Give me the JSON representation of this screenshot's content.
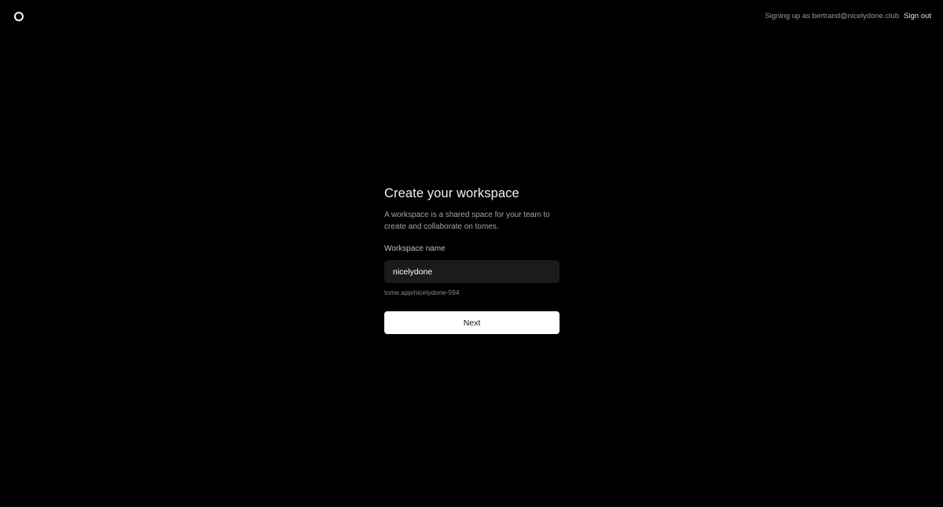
{
  "header": {
    "logo_icon": "circle-outline-icon",
    "signing_up_text": "Signing up as bertrand@nicelydone.club",
    "sign_out_label": "Sign out"
  },
  "form": {
    "title": "Create your workspace",
    "description": "A workspace is a shared space for your team to create and collaborate on tomes.",
    "workspace_label": "Workspace name",
    "workspace_value": "nicelydone",
    "url_hint": "tome.app/nicelydone-594",
    "next_label": "Next"
  },
  "colors": {
    "background": "#000000",
    "input_background": "#1b1b1b",
    "button_background": "#ffffff"
  }
}
